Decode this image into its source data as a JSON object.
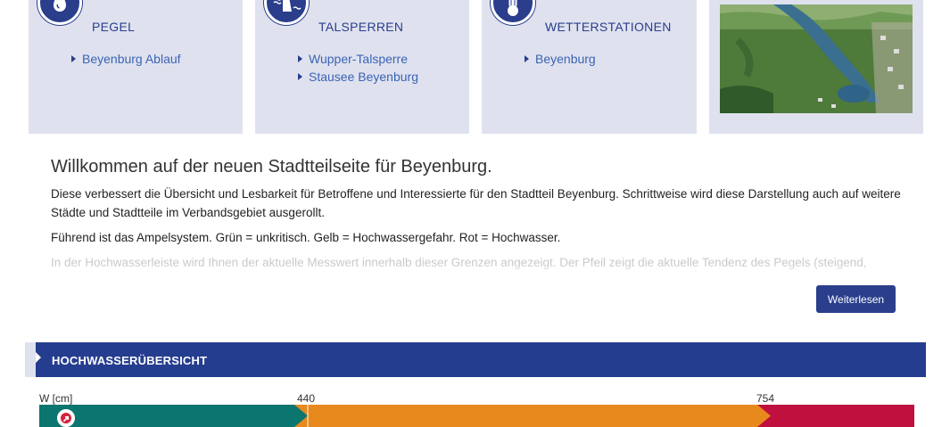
{
  "cards": [
    {
      "title": "PEGEL",
      "icon": "water-drop-icon",
      "links": [
        "Beyenburg Ablauf"
      ]
    },
    {
      "title": "TALSPERREN",
      "icon": "dam-icon",
      "links": [
        "Wupper-Talsperre",
        "Stausee Beyenburg"
      ]
    },
    {
      "title": "WETTERSTATIONEN",
      "icon": "thermometer-icon",
      "links": [
        "Beyenburg"
      ]
    }
  ],
  "welcome": {
    "heading": "Willkommen auf der neuen Stadtteilseite für Beyenburg.",
    "p1": "Diese verbessert die Übersicht und Lesbarkeit für Betroffene und Interessierte für den Stadtteil Beyenburg. Schrittweise wird diese Darstellung auch auf weitere Städte und Stadtteile im Verbandsgebiet ausgerollt.",
    "p2": "Führend ist das Ampelsystem. Grün = unkritisch. Gelb = Hochwassergefahr. Rot = Hochwasser.",
    "p3": "In der Hochwasserleiste wird Ihnen der aktuelle Messwert innerhalb dieser Grenzen angezeigt. Der Pfeil zeigt die aktuelle Tendenz des Pegels (steigend,",
    "more_label": "Weiterlesen"
  },
  "section": {
    "title": "HOCHWASSERÜBERSICHT"
  },
  "flood_scale": {
    "unit_label": "W [cm]",
    "threshold_1": "440",
    "threshold_2": "754",
    "colors": {
      "green": "#0b7570",
      "orange": "#e8891e",
      "red": "#c0103d",
      "marker": "#d6223f"
    },
    "trend": "rising"
  }
}
